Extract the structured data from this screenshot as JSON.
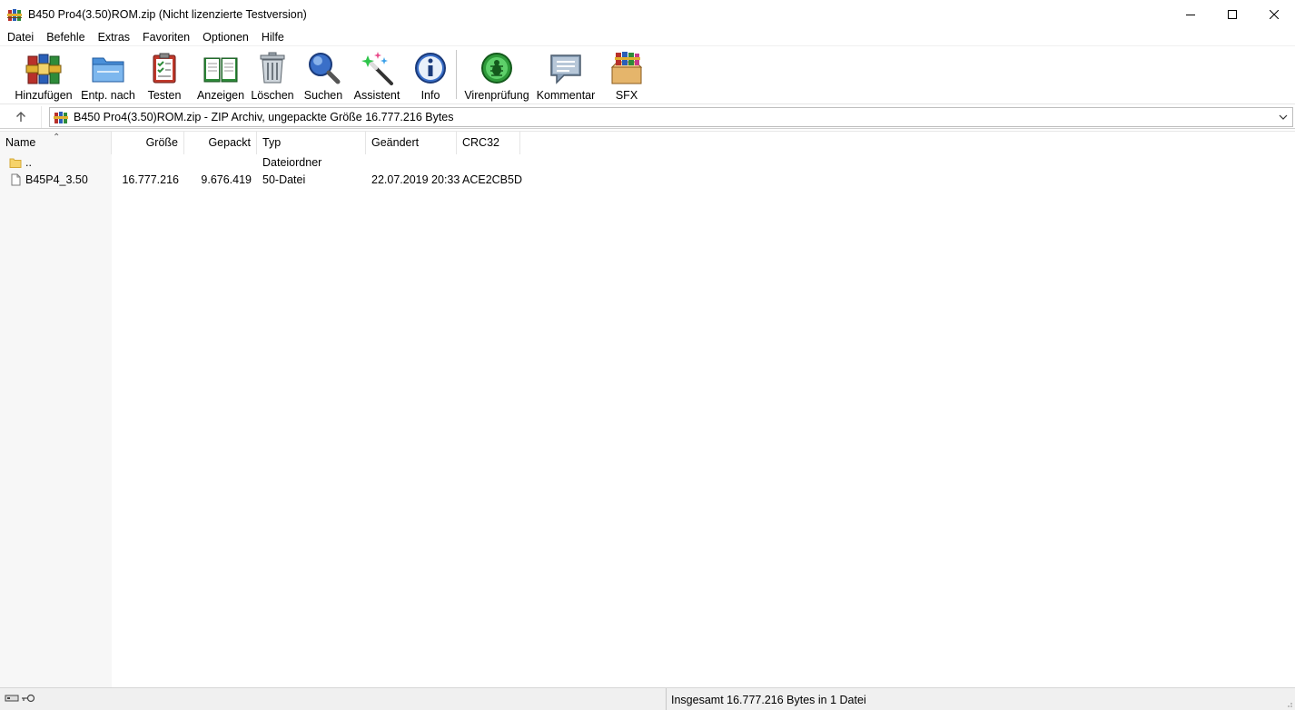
{
  "window": {
    "title": "B450 Pro4(3.50)ROM.zip (Nicht lizenzierte Testversion)"
  },
  "menu": [
    "Datei",
    "Befehle",
    "Extras",
    "Favoriten",
    "Optionen",
    "Hilfe"
  ],
  "toolbar": {
    "items": [
      {
        "label": "Hinzufügen",
        "icon": "add-archive-icon"
      },
      {
        "label": "Entp. nach",
        "icon": "extract-to-icon"
      },
      {
        "label": "Testen",
        "icon": "test-clipboard-icon"
      },
      {
        "label": "Anzeigen",
        "icon": "view-book-icon"
      },
      {
        "label": "Löschen",
        "icon": "trash-icon"
      },
      {
        "label": "Suchen",
        "icon": "magnifier-icon"
      },
      {
        "label": "Assistent",
        "icon": "wizard-wand-icon"
      },
      {
        "label": "Info",
        "icon": "info-icon"
      },
      {
        "label": "Virenprüfung",
        "icon": "virus-scan-icon"
      },
      {
        "label": "Kommentar",
        "icon": "comment-icon"
      },
      {
        "label": "SFX",
        "icon": "sfx-box-icon"
      }
    ]
  },
  "address": {
    "path": "B450 Pro4(3.50)ROM.zip - ZIP Archiv, ungepackte Größe 16.777.216 Bytes"
  },
  "columns": [
    "Name",
    "Größe",
    "Gepackt",
    "Typ",
    "Geändert",
    "CRC32"
  ],
  "files": [
    {
      "name": "..",
      "size": "",
      "packed": "",
      "type": "Dateiordner",
      "modified": "",
      "crc": "",
      "icon": "folder-icon"
    },
    {
      "name": "B45P4_3.50",
      "size": "16.777.216",
      "packed": "9.676.419",
      "type": "50-Datei",
      "modified": "22.07.2019 20:33",
      "crc": "ACE2CB5D",
      "icon": "file-icon"
    }
  ],
  "status": {
    "text": "Insgesamt 16.777.216 Bytes in 1 Datei"
  }
}
